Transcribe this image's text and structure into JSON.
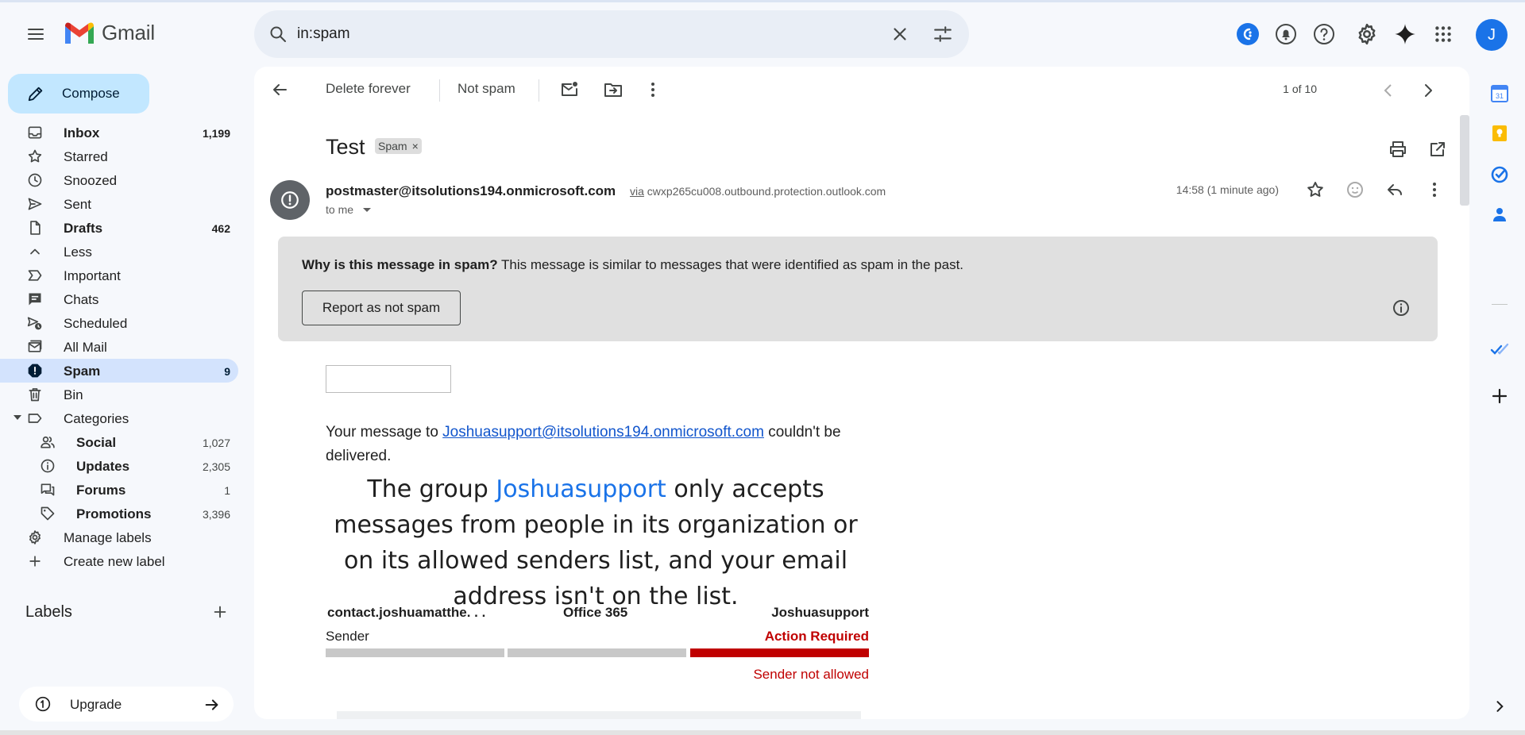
{
  "app": {
    "name": "Gmail"
  },
  "search": {
    "value": "in:spam"
  },
  "colors": {
    "accent": "#1a73e8",
    "compose_bg": "#c2e7ff",
    "active_nav": "#d3e3fd",
    "danger": "#c00000"
  },
  "header": {
    "avatar_initial": "J"
  },
  "sidebar": {
    "compose_label": "Compose",
    "items": [
      {
        "label": "Inbox",
        "count": "1,199",
        "icon": "inbox-icon",
        "bold": true
      },
      {
        "label": "Starred",
        "count": "",
        "icon": "star-icon"
      },
      {
        "label": "Snoozed",
        "count": "",
        "icon": "clock-icon"
      },
      {
        "label": "Sent",
        "count": "",
        "icon": "send-icon"
      },
      {
        "label": "Drafts",
        "count": "462",
        "icon": "draft-icon",
        "bold": true
      },
      {
        "label": "Less",
        "count": "",
        "icon": "chevron-up-icon"
      },
      {
        "label": "Important",
        "count": "",
        "icon": "important-icon"
      },
      {
        "label": "Chats",
        "count": "",
        "icon": "chat-icon"
      },
      {
        "label": "Scheduled",
        "count": "",
        "icon": "scheduled-send-icon"
      },
      {
        "label": "All Mail",
        "count": "",
        "icon": "all-mail-icon"
      },
      {
        "label": "Spam",
        "count": "9",
        "icon": "spam-icon",
        "bold": true,
        "active": true
      },
      {
        "label": "Bin",
        "count": "",
        "icon": "bin-icon"
      },
      {
        "label": "Categories",
        "count": "",
        "icon": "label-icon"
      },
      {
        "label": "Social",
        "count": "1,027",
        "icon": "social-icon",
        "bold": true,
        "sub": true
      },
      {
        "label": "Updates",
        "count": "2,305",
        "icon": "info-icon",
        "bold": true,
        "sub": true
      },
      {
        "label": "Forums",
        "count": "1",
        "icon": "forum-icon",
        "bold": true,
        "sub": true
      },
      {
        "label": "Promotions",
        "count": "3,396",
        "icon": "tag-icon",
        "bold": true,
        "sub": true
      },
      {
        "label": "Manage labels",
        "count": "",
        "icon": "gear-icon"
      },
      {
        "label": "Create new label",
        "count": "",
        "icon": "plus-icon"
      }
    ],
    "labels_header": "Labels",
    "upgrade_label": "Upgrade"
  },
  "toolbar": {
    "delete_forever": "Delete forever",
    "not_spam": "Not spam",
    "pager": "1 of 10"
  },
  "message": {
    "subject": "Test",
    "chip": "Spam",
    "chip_close": "×",
    "sender": "postmaster@itsolutions194.onmicrosoft.com",
    "via_word": "via",
    "via_host": "cwxp265cu008.outbound.protection.outlook.com",
    "to": "to me",
    "time": "14:58 (1 minute ago)",
    "spam_why_bold": "Why is this message in spam?",
    "spam_why_rest": " This message is similar to messages that were identified as spam in the past.",
    "report_label": "Report as not spam",
    "body_pre": "Your message to ",
    "body_link": "Joshuasupport@itsolutions194.onmicrosoft.com",
    "body_post": " couldn't be delivered.",
    "big_pre": "The group ",
    "big_group": "Joshuasupport",
    "big_post": " only accepts messages from people in its organization or on its allowed senders list, and your email address isn't on the list.",
    "flow": {
      "sender_name": "contact.joshuamatthe. . .",
      "sender_sub": "Sender",
      "mid_name": "Office 365",
      "dest_name": "Joshuasupport",
      "dest_status": "Action Required",
      "dest_note": "Sender not allowed"
    }
  }
}
